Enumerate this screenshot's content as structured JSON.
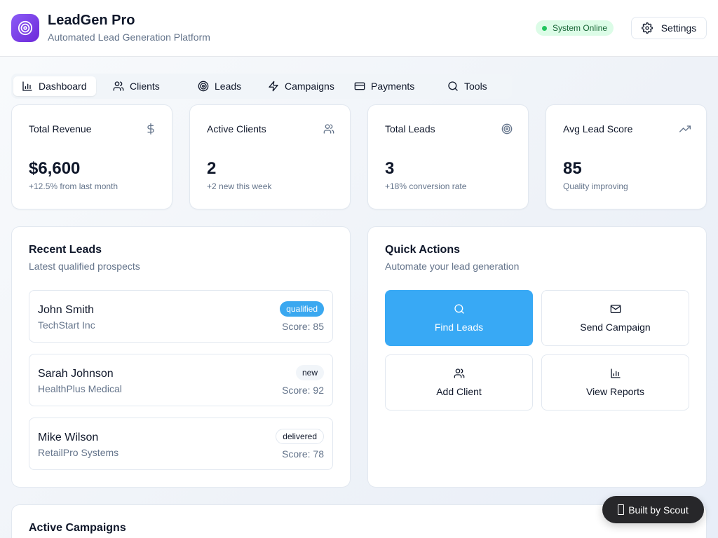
{
  "header": {
    "title": "LeadGen Pro",
    "subtitle": "Automated Lead Generation Platform",
    "status": "System Online",
    "settings_label": "Settings"
  },
  "tabs": [
    {
      "label": "Dashboard",
      "icon": "bar-chart-icon",
      "active": true
    },
    {
      "label": "Clients",
      "icon": "users-icon",
      "active": false
    },
    {
      "label": "Leads",
      "icon": "target-icon",
      "active": false
    },
    {
      "label": "Campaigns",
      "icon": "zap-icon",
      "active": false
    },
    {
      "label": "Payments",
      "icon": "credit-card-icon",
      "active": false
    },
    {
      "label": "Tools",
      "icon": "search-icon",
      "active": false
    }
  ],
  "stats": [
    {
      "title": "Total Revenue",
      "value": "$6,600",
      "sub": "+12.5% from last month",
      "icon": "dollar-icon"
    },
    {
      "title": "Active Clients",
      "value": "2",
      "sub": "+2 new this week",
      "icon": "users-icon"
    },
    {
      "title": "Total Leads",
      "value": "3",
      "sub": "+18% conversion rate",
      "icon": "target-icon"
    },
    {
      "title": "Avg Lead Score",
      "value": "85",
      "sub": "Quality improving",
      "icon": "trending-up-icon"
    }
  ],
  "recent_leads": {
    "title": "Recent Leads",
    "subtitle": "Latest qualified prospects",
    "items": [
      {
        "name": "John Smith",
        "company": "TechStart Inc",
        "status": "qualified",
        "score": "Score: 85"
      },
      {
        "name": "Sarah Johnson",
        "company": "HealthPlus Medical",
        "status": "new",
        "score": "Score: 92"
      },
      {
        "name": "Mike Wilson",
        "company": "RetailPro Systems",
        "status": "delivered",
        "score": "Score: 78"
      }
    ]
  },
  "quick_actions": {
    "title": "Quick Actions",
    "subtitle": "Automate your lead generation",
    "items": [
      {
        "label": "Find Leads",
        "icon": "search-icon",
        "primary": true
      },
      {
        "label": "Send Campaign",
        "icon": "mail-icon",
        "primary": false
      },
      {
        "label": "Add Client",
        "icon": "users-icon",
        "primary": false
      },
      {
        "label": "View Reports",
        "icon": "bar-chart-icon",
        "primary": false
      }
    ]
  },
  "campaigns": {
    "title": "Active Campaigns"
  },
  "scout_badge": "Built by Scout",
  "colors": {
    "accent": "#38a9f5",
    "logo": "#7c3aed",
    "status_bg": "#dcfce7",
    "status_dot": "#22c55e"
  }
}
